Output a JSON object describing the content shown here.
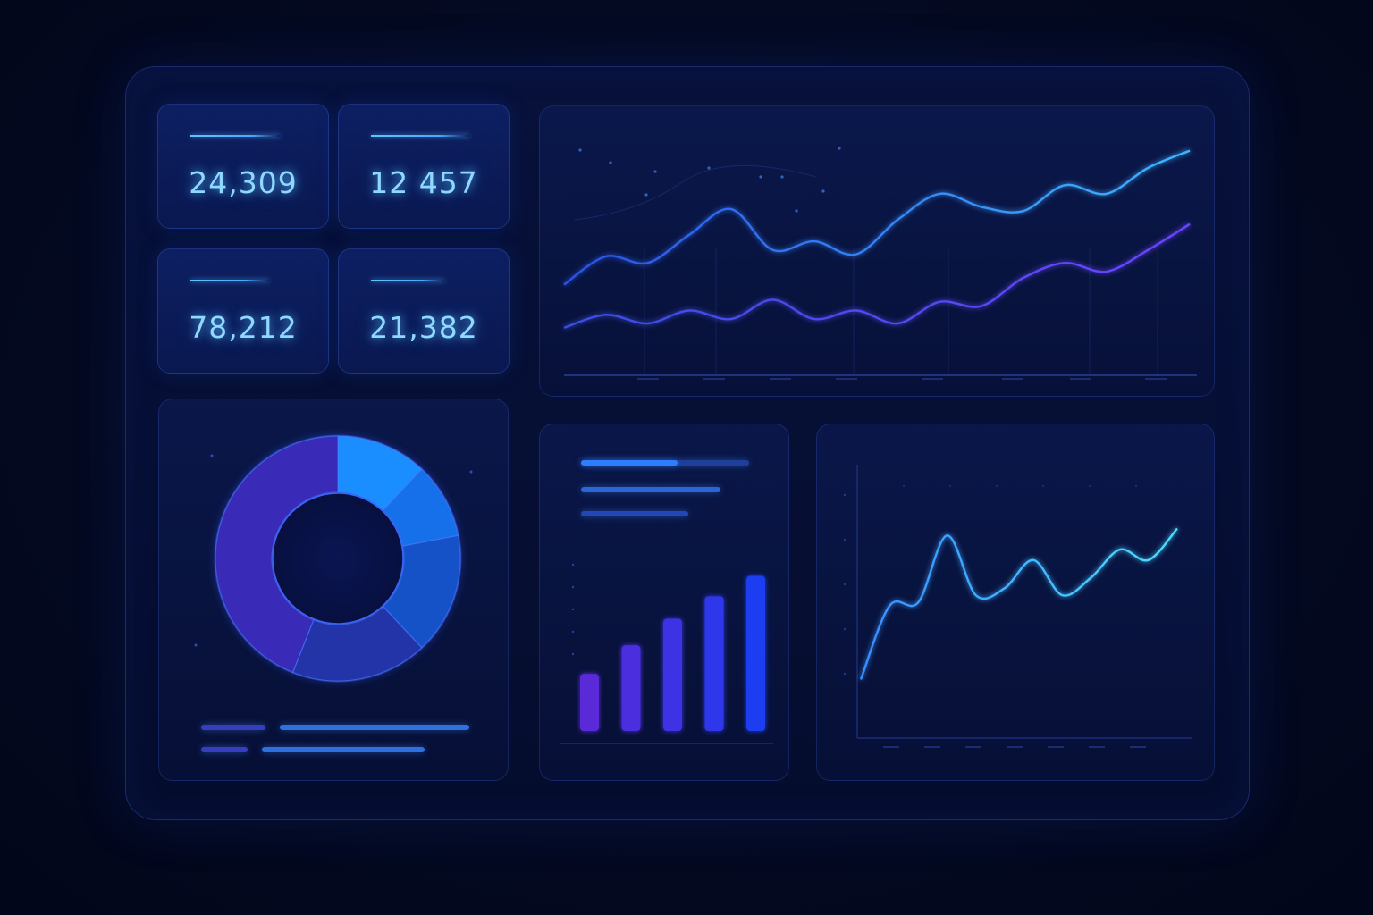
{
  "kpis": [
    {
      "value": "24,309"
    },
    {
      "value": "12 457"
    },
    {
      "value": "78,212"
    },
    {
      "value": "21,382"
    }
  ],
  "colors": {
    "accent_cyan": "#5fc4ff",
    "accent_blue": "#2a7bff",
    "accent_violet": "#6a3cff",
    "background": "#040a22"
  },
  "chart_data": [
    {
      "type": "line",
      "series": [
        {
          "values": [
            42,
            55,
            52,
            65,
            77,
            58,
            62,
            56,
            72,
            84,
            78,
            76,
            88,
            84,
            96,
            104
          ]
        },
        {
          "values": [
            22,
            28,
            24,
            30,
            26,
            35,
            26,
            30,
            24,
            34,
            32,
            45,
            52,
            48,
            58,
            70
          ]
        }
      ],
      "ylim": [
        0,
        115
      ]
    },
    {
      "type": "pie",
      "values": [
        12,
        10,
        16,
        18,
        44
      ]
    },
    {
      "type": "bar",
      "values": [
        28,
        42,
        55,
        66,
        76
      ],
      "ylim": [
        0,
        85
      ]
    },
    {
      "type": "line",
      "series": [
        {
          "values": [
            10,
            52,
            54,
            92,
            58,
            62,
            78,
            58,
            68,
            84,
            78,
            96
          ]
        }
      ],
      "ylim": [
        0,
        110
      ]
    }
  ]
}
